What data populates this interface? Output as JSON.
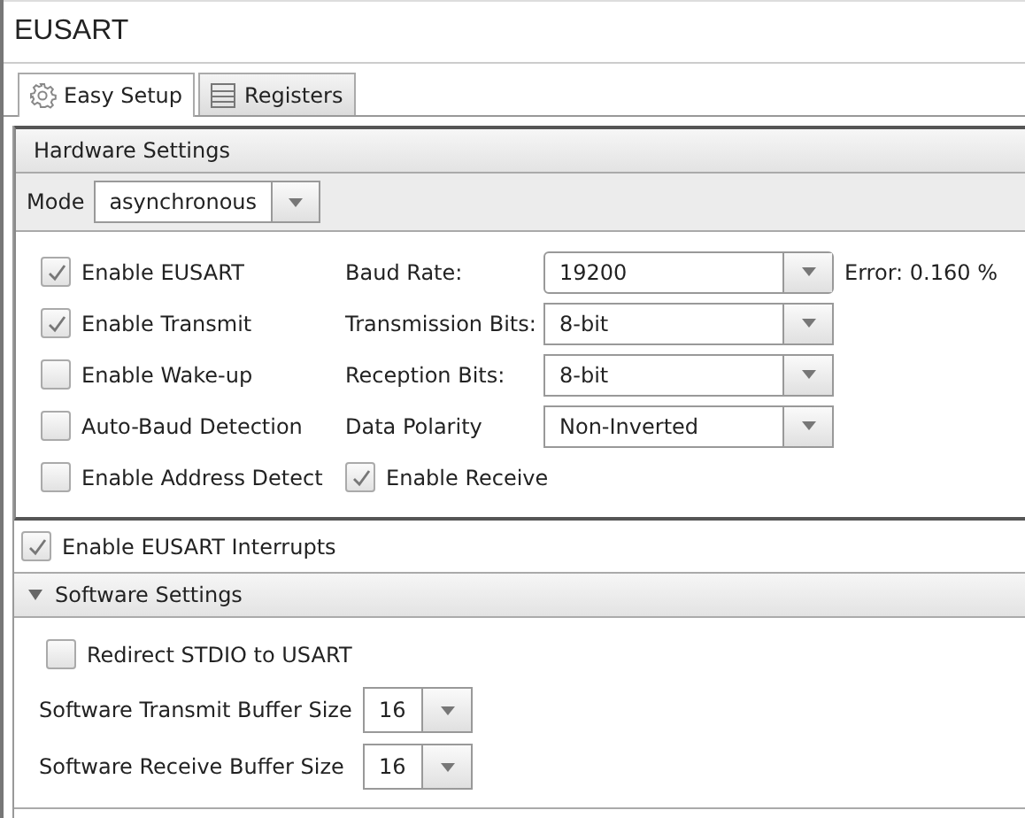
{
  "window": {
    "title": "EUSART"
  },
  "tabs": [
    {
      "label": "Easy Setup",
      "kind": "settings",
      "selected": true
    },
    {
      "label": "Registers",
      "kind": "registers",
      "selected": false
    }
  ],
  "hardware_settings": {
    "title": "Hardware Settings",
    "mode": {
      "label": "Mode",
      "value": "asynchronous"
    },
    "options": [
      {
        "label": "Enable EUSART",
        "checked": true
      },
      {
        "label": "Enable Transmit",
        "checked": true
      },
      {
        "label": "Enable Wake-up",
        "checked": false
      },
      {
        "label": "Auto-Baud Detection",
        "checked": false
      },
      {
        "label": "Enable Address Detect",
        "checked": false
      }
    ],
    "fields": [
      {
        "label": "Baud Rate:",
        "value": "19200",
        "kind": "combo",
        "note": "Error: 0.160 %"
      },
      {
        "label": "Transmission Bits:",
        "value": "8-bit",
        "kind": "select"
      },
      {
        "label": "Reception Bits:",
        "value": "8-bit",
        "kind": "select"
      },
      {
        "label": "Data Polarity",
        "value": "Non-Inverted",
        "kind": "select"
      }
    ],
    "enable_receive": {
      "label": "Enable Receive",
      "checked": true
    }
  },
  "interrupts": {
    "label": "Enable EUSART Interrupts",
    "checked": true
  },
  "software_settings": {
    "title": "Software Settings",
    "expanded": true,
    "redirect": {
      "label": "Redirect STDIO to USART",
      "checked": false
    },
    "fields": [
      {
        "label": "Software Transmit Buffer Size",
        "value": "16"
      },
      {
        "label": "Software Receive Buffer Size",
        "value": "16"
      }
    ]
  }
}
